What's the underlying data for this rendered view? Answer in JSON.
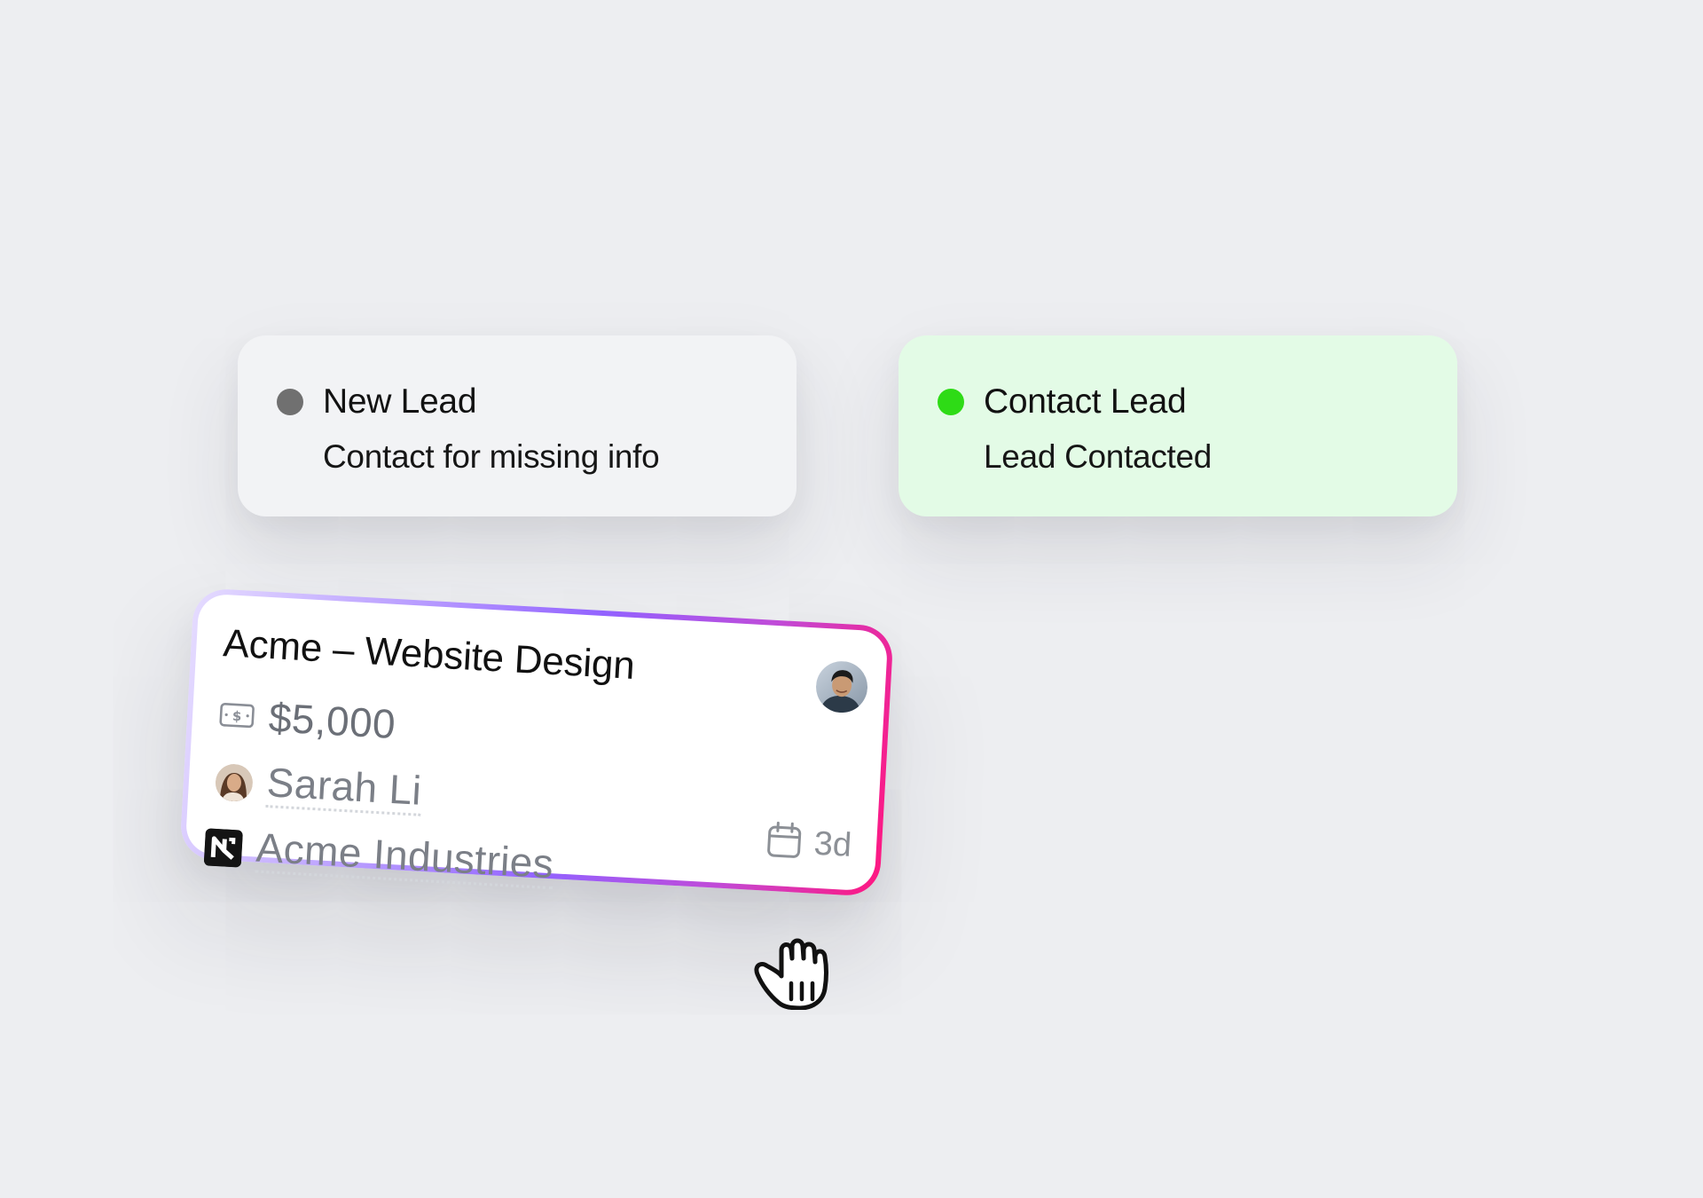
{
  "stages": [
    {
      "title": "New Lead",
      "subtitle": "Contact for missing info",
      "dot_color": "#707070",
      "background": "#f2f3f5"
    },
    {
      "title": "Contact Lead",
      "subtitle": "Lead Contacted",
      "dot_color": "#2edb16",
      "background": "#e3fbe6"
    }
  ],
  "deal": {
    "title": "Acme – Website Design",
    "value": "$5,000",
    "value_icon": "money-icon",
    "contact": "Sarah Li",
    "company": "Acme Industries",
    "due": "3d",
    "due_icon": "calendar-icon",
    "owner_avatar": "owner-avatar",
    "border_gradient": [
      "#e5dcff",
      "#9262ff",
      "#ff1780"
    ]
  },
  "cursor": "grab-cursor-icon"
}
